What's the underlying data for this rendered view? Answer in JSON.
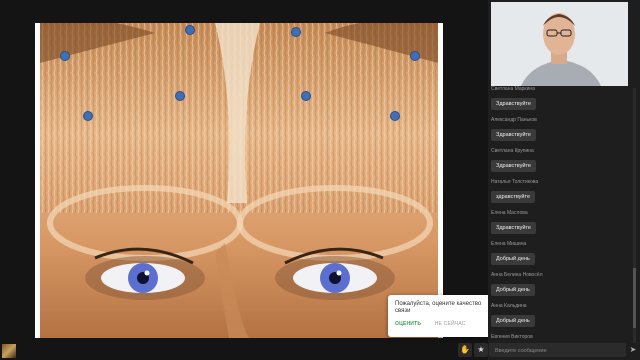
{
  "slide": {
    "markers_count_label": ""
  },
  "popup": {
    "question": "Пожалуйста, оцените качество связи",
    "rate_label": "ОЦЕНИТЬ",
    "later_label": "НЕ СЕЙЧАС"
  },
  "controls": {
    "hand_icon": "hand-icon",
    "star_icon": "star-icon"
  },
  "chat": {
    "messages": [
      {
        "author": "Светлана Маркина",
        "text": "Здравствуйте"
      },
      {
        "author": "Александр Паньков",
        "text": "Здравствуйте"
      },
      {
        "author": "Светлана Крупина",
        "text": "Здравствуйте"
      },
      {
        "author": "Наталья Толстикова",
        "text": "здравствуйте"
      },
      {
        "author": "Елена Маслова",
        "text": "Здравствуйте"
      },
      {
        "author": "Елена Мишина",
        "text": "Добрый день"
      },
      {
        "author": "Анна Белина Новосёл",
        "text": "Добрый день"
      },
      {
        "author": "Анна Кальдина",
        "text": "Добрый день"
      },
      {
        "author": "Евгения Викторов",
        "text": ""
      }
    ],
    "input_placeholder": "Введите сообщение"
  },
  "colors": {
    "marker": "#3f6fb5",
    "rate_accent": "#3a9e5a"
  }
}
